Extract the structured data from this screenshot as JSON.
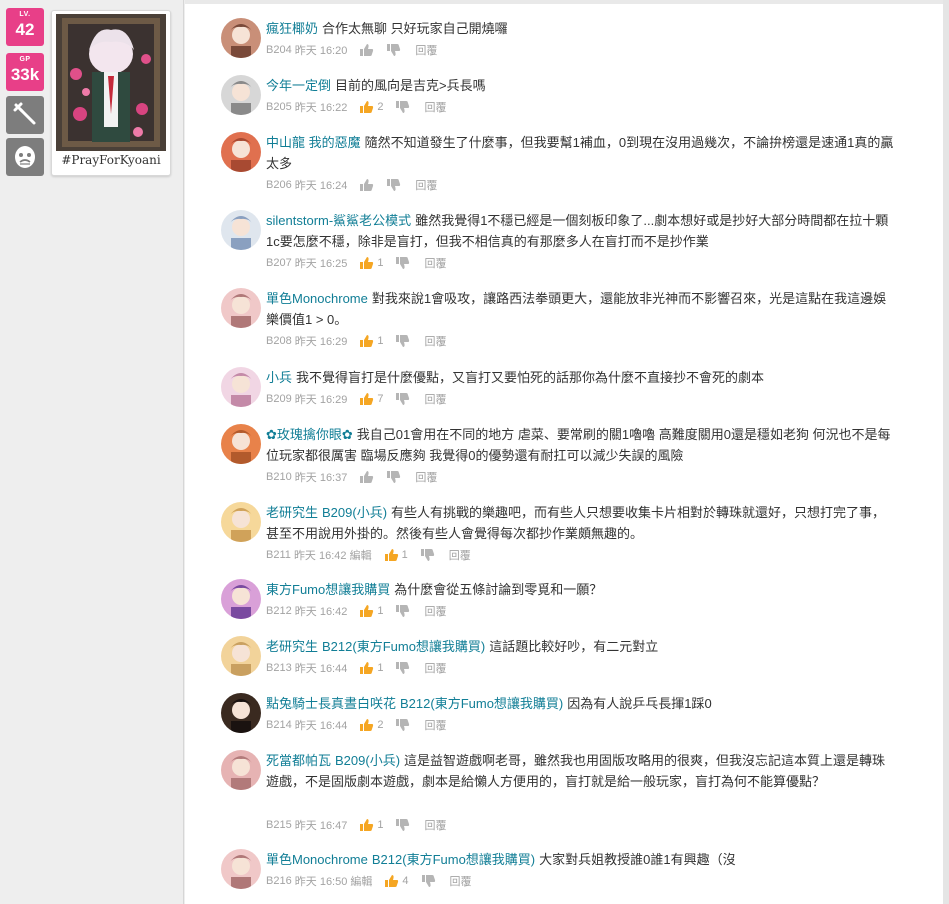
{
  "sidebar": {
    "lv_label": "LV.",
    "lv_value": "42",
    "gp_label": "GP",
    "gp_value": "33k",
    "tool_icon": "wrench-icon",
    "mask_icon": "mask-icon",
    "card_caption": "#PrayForKyoani"
  },
  "colors": {
    "accent_pink": "#e83f88",
    "name_link": "#117e96",
    "liked_orange": "#f5a623"
  },
  "comments": [
    {
      "name": "瘋狂椰奶",
      "reply_to": "",
      "text": "合作太無聊 只好玩家自己開燒囉",
      "floor": "B204",
      "time": "昨天 16:20",
      "edited": "",
      "likes": "",
      "liked": false,
      "reply_label": "回覆"
    },
    {
      "name": "今年一定倒",
      "reply_to": "",
      "text": "目前的風向是吉克>兵長嗎",
      "floor": "B205",
      "time": "昨天 16:22",
      "edited": "",
      "likes": "2",
      "liked": true,
      "reply_label": "回覆"
    },
    {
      "name": "中山龍 我的惡魔",
      "reply_to": "",
      "text": "隨然不知道發生了什麼事，但我要幫1補血，0到現在沒用過幾次，不論拚榜還是速通1真的贏太多",
      "floor": "B206",
      "time": "昨天 16:24",
      "edited": "",
      "likes": "",
      "liked": false,
      "reply_label": "回覆"
    },
    {
      "name": "silentstorm-鯊鯊老公模式",
      "reply_to": "",
      "text": "雖然我覺得1不穩已經是一個刻板印象了...劇本想好或是抄好大部分時間都在拉十顆1c要怎麼不穩，除非是盲打，但我不相信真的有那麼多人在盲打而不是抄作業",
      "floor": "B207",
      "time": "昨天 16:25",
      "edited": "",
      "likes": "1",
      "liked": true,
      "reply_label": "回覆"
    },
    {
      "name": "單色Monochrome",
      "reply_to": "",
      "text": "對我來說1會吸攻，讓路西法拳頭更大，還能放非光神而不影響召來，光是這點在我這邊娛樂價值1 > 0。",
      "floor": "B208",
      "time": "昨天 16:29",
      "edited": "",
      "likes": "1",
      "liked": true,
      "reply_label": "回覆"
    },
    {
      "name": "小兵",
      "reply_to": "",
      "text": "我不覺得盲打是什麼優點，又盲打又要怕死的話那你為什麼不直接抄不會死的劇本",
      "floor": "B209",
      "time": "昨天 16:29",
      "edited": "",
      "likes": "7",
      "liked": true,
      "reply_label": "回覆"
    },
    {
      "name": "✿玫瑰擒你眼✿",
      "reply_to": "",
      "text": "我自己01會用在不同的地方 虐菜、要常刷的關1嚕嚕 高難度關用0還是穩如老狗 何況也不是每位玩家都很厲害 臨場反應夠 我覺得0的優勢還有耐扛可以減少失誤的風險",
      "floor": "B210",
      "time": "昨天 16:37",
      "edited": "",
      "likes": "",
      "liked": false,
      "reply_label": "回覆"
    },
    {
      "name": "老研究生",
      "reply_to": "B209(小兵)",
      "text": "有些人有挑戰的樂趣吧，而有些人只想要收集卡片相對於轉珠就還好，只想打完了事，甚至不用說用外掛的。然後有些人會覺得每次都抄作業頗無趣的。",
      "floor": "B211",
      "time": "昨天 16:42",
      "edited": "編輯",
      "likes": "1",
      "liked": true,
      "reply_label": "回覆"
    },
    {
      "name": "東方Fumo想讓我購買",
      "reply_to": "",
      "text": "為什麼會從五條討論到零覓和一願？",
      "floor": "B212",
      "time": "昨天 16:42",
      "edited": "",
      "likes": "1",
      "liked": true,
      "reply_label": "回覆"
    },
    {
      "name": "老研究生",
      "reply_to": "B212(東方Fumo想讓我購買)",
      "text": "這話題比較好吵，有二元對立",
      "floor": "B213",
      "time": "昨天 16:44",
      "edited": "",
      "likes": "1",
      "liked": true,
      "reply_label": "回覆"
    },
    {
      "name": "點兔騎士長真晝白咲花",
      "reply_to": "B212(東方Fumo想讓我購買)",
      "text": "因為有人說乒乓長揮1踩0",
      "floor": "B214",
      "time": "昨天 16:44",
      "edited": "",
      "likes": "2",
      "liked": true,
      "reply_label": "回覆"
    },
    {
      "name": "死當都帕瓦",
      "reply_to": "B209(小兵)",
      "text": "這是益智遊戲啊老哥，雖然我也用固版攻略用的很爽，但我沒忘記這本質上還是轉珠遊戲，不是固版劇本遊戲，劇本是給懶人方便用的，盲打就是給一般玩家，盲打為何不能算優點？",
      "floor": "B215",
      "time": "昨天 16:47",
      "edited": "",
      "likes": "1",
      "liked": true,
      "reply_label": "回覆"
    },
    {
      "name": "單色Monochrome",
      "reply_to": "B212(東方Fumo想讓我購買)",
      "text": "大家對兵姐教授誰0誰1有興趣（沒",
      "floor": "B216",
      "time": "昨天 16:50",
      "edited": "編輯",
      "likes": "4",
      "liked": true,
      "reply_label": "回覆"
    }
  ]
}
